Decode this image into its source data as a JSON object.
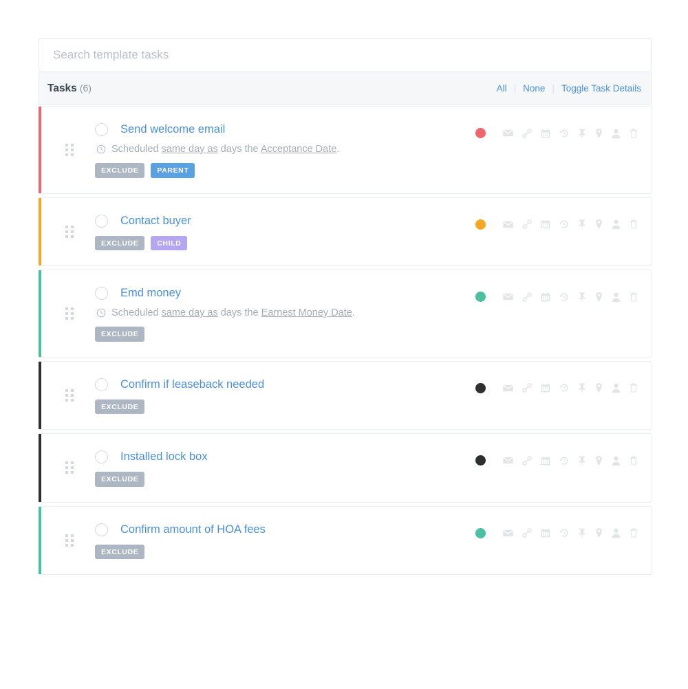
{
  "search": {
    "placeholder": "Search template tasks",
    "value": "",
    "name": "search-input"
  },
  "header": {
    "title": "Tasks",
    "count": "(6)",
    "links": {
      "all": "All",
      "none": "None",
      "toggle_details": "Toggle Task Details"
    },
    "separator": "|"
  },
  "colors": {
    "red": "#f0666e",
    "orange": "#f5a623",
    "green": "#4ac0a0",
    "dark": "#2d2f31",
    "link_blue": "#4a90d9",
    "badge_exclude": "#adb7c4",
    "badge_parent": "#5aa1e3",
    "badge_child": "#b4a6f0",
    "icon_gray": "#e2e5e8",
    "header_bg": "#f6f7f8"
  },
  "action_icons": [
    "envelope-icon",
    "link-chain-icon",
    "calendar-icon",
    "history-icon",
    "pin-icon",
    "map-marker-icon",
    "user-icon",
    "trash-icon"
  ],
  "tasks": [
    {
      "title": "Send welcome email",
      "accent_color": "#f0666e",
      "status_color": "#f0666e",
      "checked": false,
      "schedule": {
        "visible": true,
        "prefix": "Scheduled ",
        "link1": "same day as",
        "middle": " days the ",
        "link2": "Acceptance Date",
        "suffix": "."
      },
      "badges": [
        {
          "label": "EXCLUDE",
          "style": "exclude"
        },
        {
          "label": "PARENT",
          "style": "parent"
        }
      ]
    },
    {
      "title": "Contact buyer",
      "accent_color": "#f5a623",
      "status_color": "#f5a623",
      "checked": false,
      "schedule": {
        "visible": false
      },
      "badges": [
        {
          "label": "EXCLUDE",
          "style": "exclude"
        },
        {
          "label": "CHILD",
          "style": "child"
        }
      ]
    },
    {
      "title": "Emd money",
      "accent_color": "#4ac0a0",
      "status_color": "#4ac0a0",
      "checked": false,
      "schedule": {
        "visible": true,
        "prefix": "Scheduled ",
        "link1": "same day as",
        "middle": " days the ",
        "link2": "Earnest Money Date",
        "suffix": "."
      },
      "badges": [
        {
          "label": "EXCLUDE",
          "style": "exclude"
        }
      ]
    },
    {
      "title": "Confirm if leaseback needed",
      "accent_color": "#2d2f31",
      "status_color": "#2d2f31",
      "checked": false,
      "schedule": {
        "visible": false
      },
      "badges": [
        {
          "label": "EXCLUDE",
          "style": "exclude"
        }
      ]
    },
    {
      "title": "Installed lock box",
      "accent_color": "#2d2f31",
      "status_color": "#2d2f31",
      "checked": false,
      "schedule": {
        "visible": false
      },
      "badges": [
        {
          "label": "EXCLUDE",
          "style": "exclude"
        }
      ]
    },
    {
      "title": "Confirm amount of HOA fees",
      "accent_color": "#4ac0a0",
      "status_color": "#4ac0a0",
      "checked": false,
      "schedule": {
        "visible": false
      },
      "badges": [
        {
          "label": "EXCLUDE",
          "style": "exclude"
        }
      ]
    }
  ]
}
